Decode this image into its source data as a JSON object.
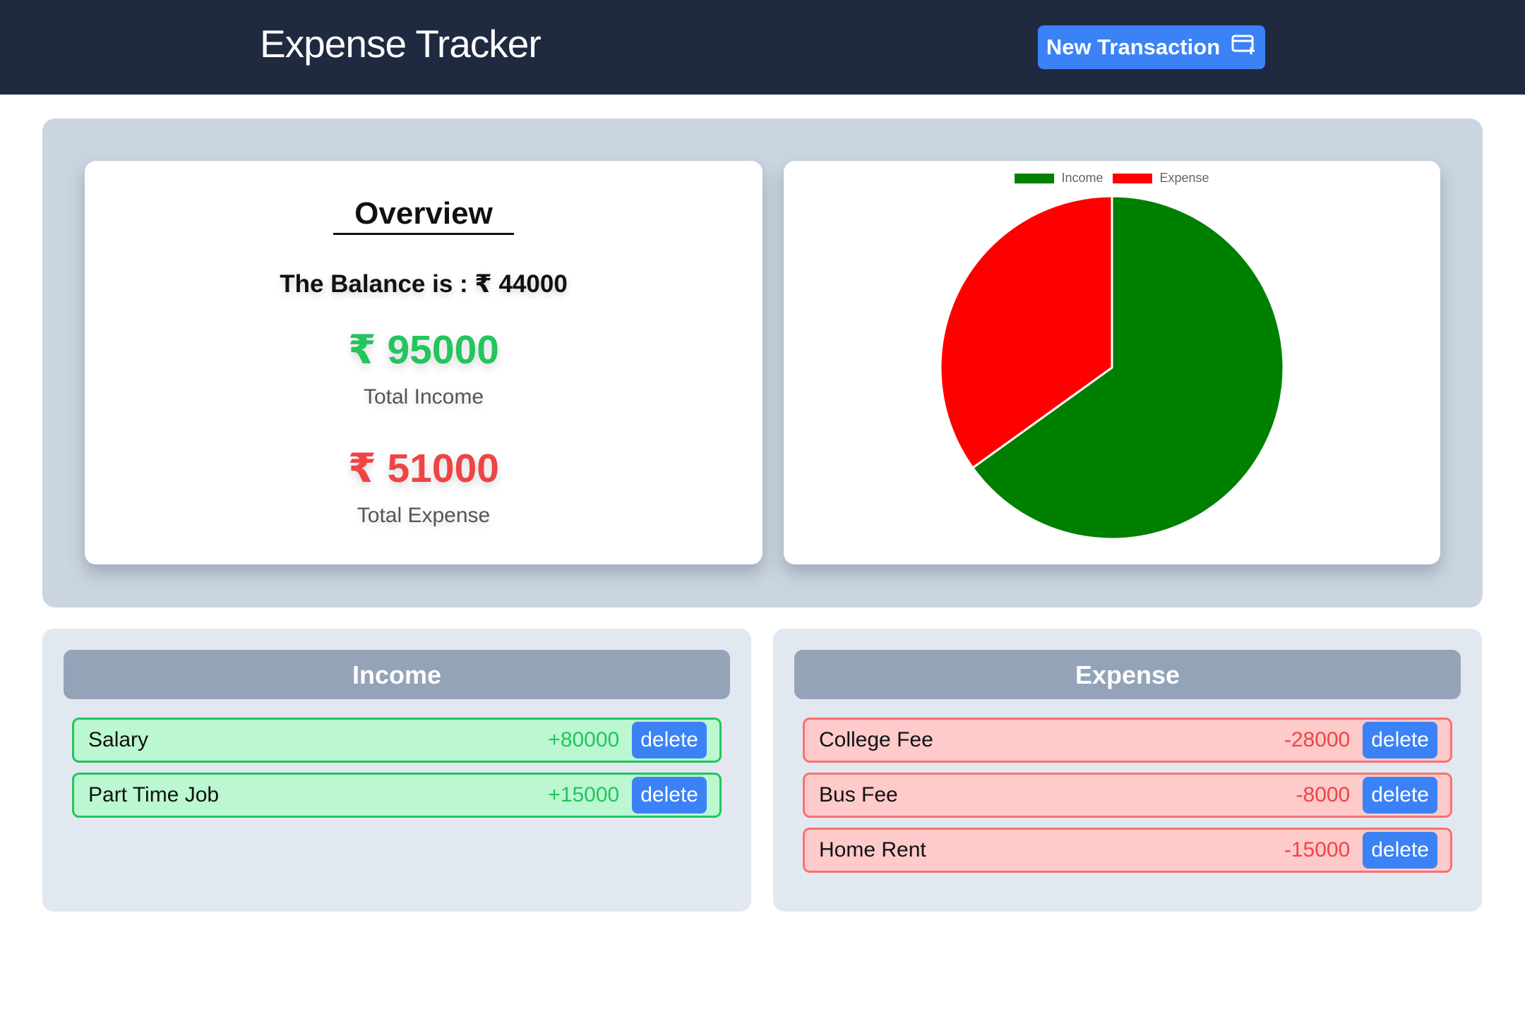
{
  "header": {
    "title": "Expense Tracker",
    "new_transaction_label": "New Transaction",
    "new_transaction_icon": "card-plus-icon"
  },
  "overview": {
    "title": "Overview",
    "balance_text": "The Balance is : ₹ 44000",
    "total_income_value": "₹ 95000",
    "total_income_label": "Total Income",
    "total_expense_value": "₹ 51000",
    "total_expense_label": "Total Expense"
  },
  "chart_data": {
    "type": "pie",
    "categories": [
      "Income",
      "Expense"
    ],
    "values": [
      95000,
      51000
    ],
    "colors": [
      "#008000",
      "#ff0000"
    ],
    "legend": "top"
  },
  "income_panel": {
    "title": "Income",
    "items": [
      {
        "name": "Salary",
        "amount": "+80000",
        "action": "delete"
      },
      {
        "name": "Part Time Job",
        "amount": "+15000",
        "action": "delete"
      }
    ]
  },
  "expense_panel": {
    "title": "Expense",
    "items": [
      {
        "name": "College Fee",
        "amount": "-28000",
        "action": "delete"
      },
      {
        "name": "Bus Fee",
        "amount": "-8000",
        "action": "delete"
      },
      {
        "name": "Home Rent",
        "amount": "-15000",
        "action": "delete"
      }
    ]
  }
}
